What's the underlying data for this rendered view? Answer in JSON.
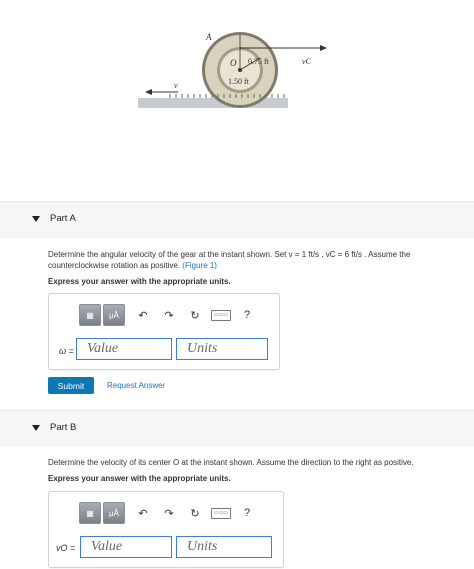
{
  "figure": {
    "labels": {
      "A": "A",
      "O": "O",
      "r_inner": "0.75 ft",
      "r_outer": "1.50 ft",
      "v": "v",
      "vC": "vC"
    }
  },
  "partA": {
    "title": "Part A",
    "question_line1": "Determine the angular velocity of the gear at the instant shown. Set v = 1 ft/s , vC = 6 ft/s . Assume the",
    "question_line2": "counterclockwise rotation as positive.",
    "figure_link": "(Figure 1)",
    "express": "Express your answer with the appropriate units.",
    "var_label": "ω =",
    "value_placeholder": "Value",
    "units_placeholder": "Units",
    "submit": "Submit",
    "request": "Request Answer"
  },
  "partB": {
    "title": "Part B",
    "question": "Determine the velocity of its center O at the instant shown. Assume the direction to the right as positive.",
    "express": "Express your answer with the appropriate units.",
    "var_label": "vO =",
    "value_placeholder": "Value",
    "units_placeholder": "Units"
  },
  "toolbar": {
    "mu": "μÅ",
    "help": "?",
    "kb": "▭▭▭"
  }
}
